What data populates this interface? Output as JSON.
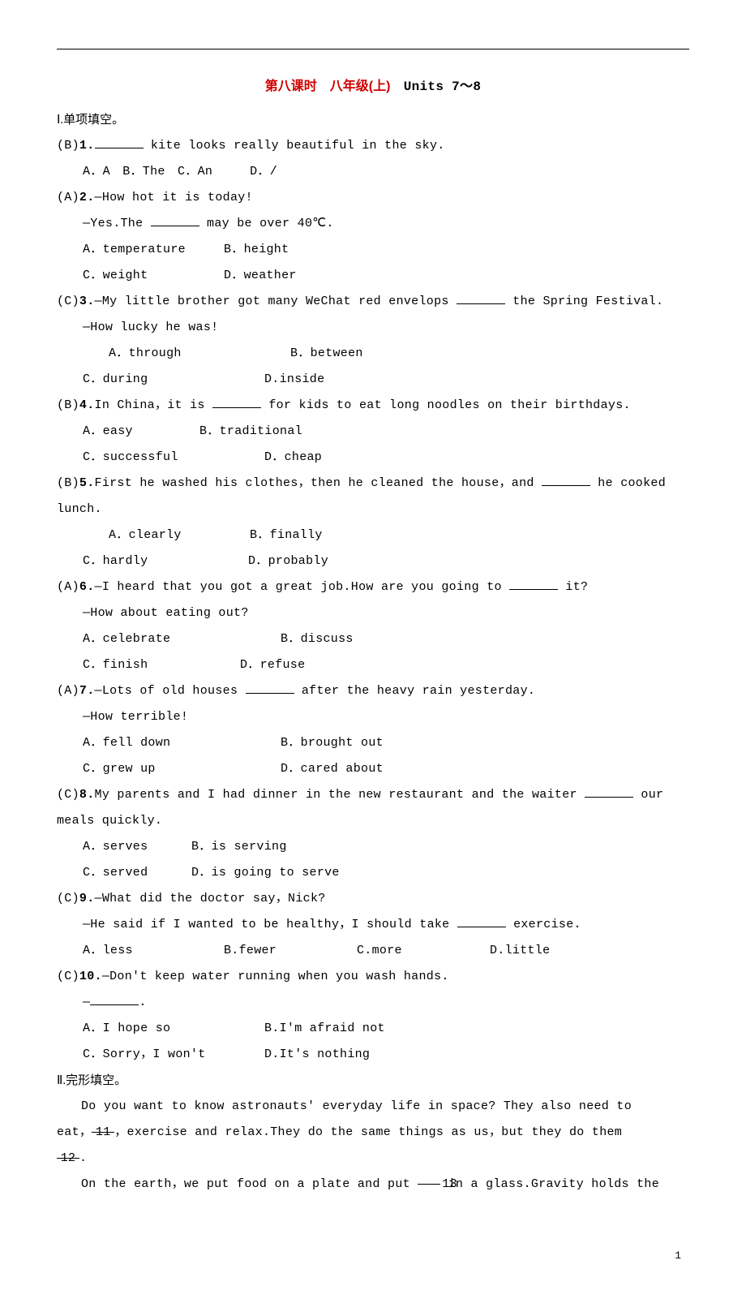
{
  "title": {
    "red": "第八课时　八年级(上)",
    "black": "　Units 7～8"
  },
  "section1": "Ⅰ.单项填空。",
  "q1": {
    "prefix": "(B)",
    "num": "1.",
    "stem_after": " kite looks really beautiful in the sky.",
    "opts": "A．A　B．The　C．An　　　D．/"
  },
  "q2": {
    "prefix": "(A)",
    "num": "2.",
    "line1": "—How hot it is today!",
    "line2a": "—Yes.The ",
    "line2b": " may be over 40℃.",
    "optA": "A．temperature",
    "optB": "B．height",
    "optC": "C．weight",
    "optD": "D．weather"
  },
  "q3": {
    "prefix": "(C)",
    "num": "3.",
    "line1a": "—My little brother got many WeChat red envelops ",
    "line1b": " the Spring Festival.",
    "line2": "—How lucky he was!",
    "optA": "A．through",
    "optB": "B．between",
    "optC": "C．during",
    "optD": "D.inside"
  },
  "q4": {
    "prefix": "(B)",
    "num": "4.",
    "line1a": "In China，it is ",
    "line1b": " for kids to eat long noodles on their birthdays.",
    "optA": "A．easy",
    "optB": "B．traditional",
    "optC": "C．successful",
    "optD": "D．cheap"
  },
  "q5": {
    "prefix": "(B)",
    "num": "5.",
    "line1a": "First he washed his clothes，then he cleaned the house，and ",
    "line1b": " he cooked",
    "line2": "lunch.",
    "optA": "A．clearly",
    "optB": "B．finally",
    "optC": "C．hardly",
    "optD": "D．probably"
  },
  "q6": {
    "prefix": "(A)",
    "num": "6.",
    "line1a": "—I heard that you got a great job.How are you going to ",
    "line1b": " it?",
    "line2": "—How about eating out?",
    "optA": "A．celebrate",
    "optB": "B．discuss",
    "optC": "C．finish",
    "optD": "D．refuse"
  },
  "q7": {
    "prefix": "(A)",
    "num": "7.",
    "line1a": "—Lots of old houses ",
    "line1b": " after the heavy rain yesterday.",
    "line2": "—How terrible!",
    "optA": "A．fell down",
    "optB": "B．brought out",
    "optC": "C．grew up",
    "optD": "D．cared about"
  },
  "q8": {
    "prefix": "(C)",
    "num": "8.",
    "line1a": "My parents and I had dinner in the new restaurant and the waiter ",
    "line1b": " our",
    "line2": "meals quickly.",
    "optA": "A．serves",
    "optB": "B．is serving",
    "optC": "C．served",
    "optD": "D．is going to serve"
  },
  "q9": {
    "prefix": "(C)",
    "num": "9.",
    "line1": "—What did the doctor say，Nick?",
    "line2a": "—He said if I wanted to be healthy，I should take ",
    "line2b": " exercise.",
    "optA": "A．less",
    "optB": "B.fewer",
    "optC": "C.more",
    "optD": "D.little"
  },
  "q10": {
    "prefix": "(C)",
    "num": "10.",
    "line1": "—Don't keep water running when you wash hands.",
    "line2a": "—",
    "line2b": ".",
    "optA": "A．I hope so",
    "optB": "B.I'm afraid not",
    "optC": "C．Sorry，I won't",
    "optD": "D.It's nothing"
  },
  "section2": "Ⅱ.完形填空。",
  "passage": {
    "p1a": "Do you want to know astronauts' everyday life in space? They also need to",
    "p1b": "eat，",
    "p1c": "，exercise and relax.They do the same things as us，but they do them",
    "blank11": "11",
    "blank12": "12",
    "p1d": ".",
    "p2a": "On the earth，we put food on a plate and put ",
    "blank13": "13",
    "p2b": " in a glass.Gravity holds the"
  },
  "page_num": "1"
}
